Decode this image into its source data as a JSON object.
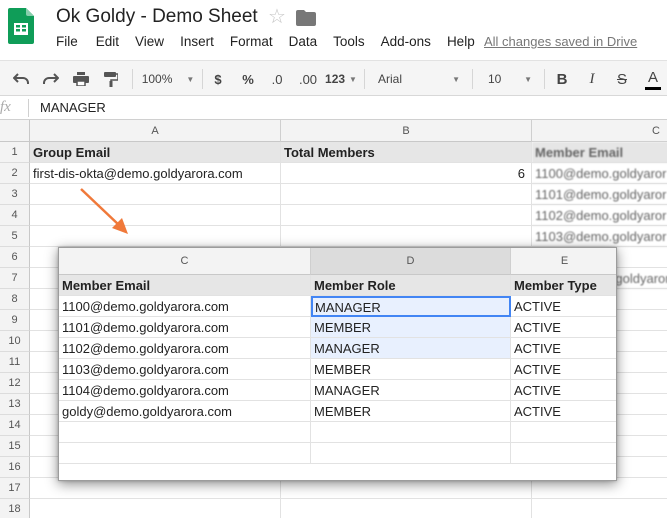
{
  "app": {
    "title": "Ok Goldy - Demo Sheet",
    "save_status": "All changes saved in Drive",
    "menu": [
      "File",
      "Edit",
      "View",
      "Insert",
      "Format",
      "Data",
      "Tools",
      "Add-ons",
      "Help"
    ]
  },
  "toolbar": {
    "zoom": "100%",
    "currency": "$",
    "percent": "%",
    "decrease_decimal": ".0",
    "increase_decimal": ".00",
    "more_formats": "123",
    "font": "Arial",
    "font_size": "10",
    "bold": "B",
    "italic": "I",
    "strike": "S",
    "text_color": "A"
  },
  "formula_bar": {
    "fx": "fx",
    "value": "MANAGER"
  },
  "grid": {
    "columns": [
      "A",
      "B",
      "C"
    ],
    "rows": [
      "1",
      "2",
      "3",
      "4",
      "5",
      "6",
      "7",
      "8",
      "9",
      "10",
      "11",
      "12",
      "13",
      "14",
      "15",
      "16",
      "17",
      "18"
    ],
    "header_row": {
      "a": "Group Email",
      "b": "Total Members",
      "c": "Member Email"
    },
    "row2": {
      "a": "first-dis-okta@demo.goldyarora.com",
      "b": "6"
    },
    "col_c_values": [
      "1100@demo.goldyaror",
      "1101@demo.goldyaror",
      "1102@demo.goldyaror",
      "1103@demo.goldyaror",
      "",
      "goldy@demo.goldyaror"
    ]
  },
  "popup": {
    "columns": [
      "C",
      "D",
      "E"
    ],
    "headers": [
      "Member Email",
      "Member Role",
      "Member Type"
    ],
    "rows": [
      [
        "1100@demo.goldyarora.com",
        "MANAGER",
        "ACTIVE"
      ],
      [
        "1101@demo.goldyarora.com",
        "MEMBER",
        "ACTIVE"
      ],
      [
        "1102@demo.goldyarora.com",
        "MANAGER",
        "ACTIVE"
      ],
      [
        "1103@demo.goldyarora.com",
        "MEMBER",
        "ACTIVE"
      ],
      [
        "1104@demo.goldyarora.com",
        "MANAGER",
        "ACTIVE"
      ],
      [
        "goldy@demo.goldyarora.com",
        "MEMBER",
        "ACTIVE"
      ]
    ]
  },
  "colors": {
    "sheets_green": "#0f9d58",
    "arrow_orange": "#f0793a",
    "selection_blue": "#4285f4",
    "selection_fill": "#e8f0fe"
  }
}
